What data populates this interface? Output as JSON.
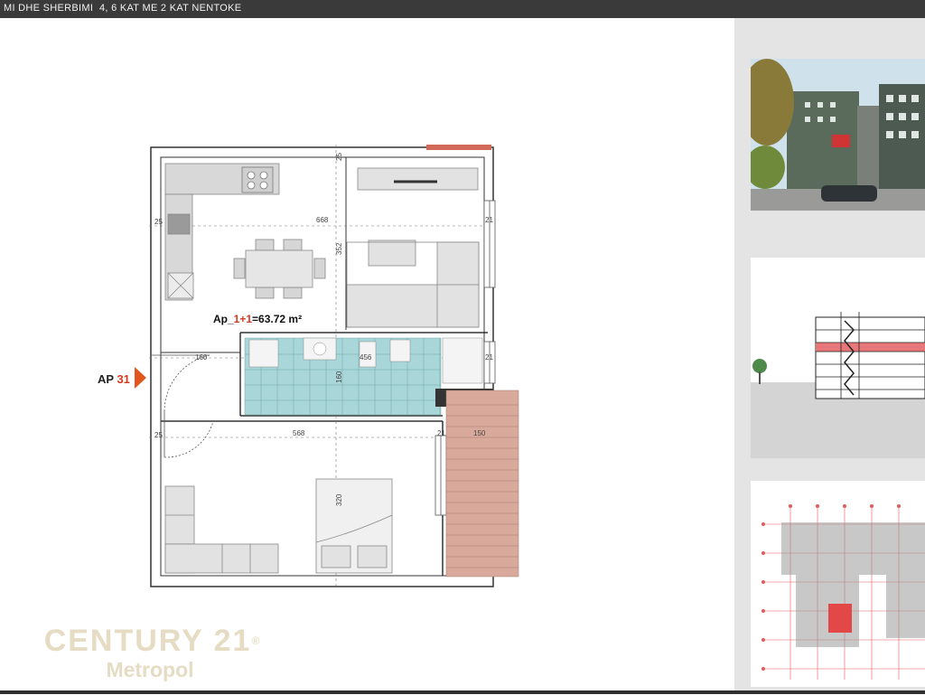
{
  "header": {
    "title": "MI DHE SHERBIMI  4, 6 KAT ME 2 KAT NENTOKE"
  },
  "plan": {
    "apartment_label": "AP",
    "apartment_number": "31",
    "area_prefix": "Ap_",
    "area_type": "1+1",
    "area_value": "=63.72 m²",
    "dimensions": {
      "d_668": "668",
      "d_352": "352",
      "d_160_corridor": "160",
      "d_456": "456",
      "d_160_bath": "160",
      "d_568": "568",
      "d_320": "320",
      "d_150": "150",
      "d_25_top": "25",
      "d_25_left": "25",
      "d_25_mid": "25",
      "d_21_a": "21",
      "d_21_b": "21",
      "d_21_c": "21"
    }
  },
  "brand": {
    "name": "CENTURY 21",
    "registered": "®",
    "office": "Metropol"
  },
  "colors": {
    "header_bg": "#3a3a3a",
    "bathroom_tile": "#a9d6d8",
    "balcony": "#d9aa9c",
    "arrow": "#e2551e",
    "brand": "#e6dcc4",
    "sidebar_bg": "#e4e4e4"
  },
  "thumbnails": [
    {
      "name": "building-exterior-photo"
    },
    {
      "name": "building-section-drawing"
    },
    {
      "name": "floor-plan-overview"
    }
  ]
}
